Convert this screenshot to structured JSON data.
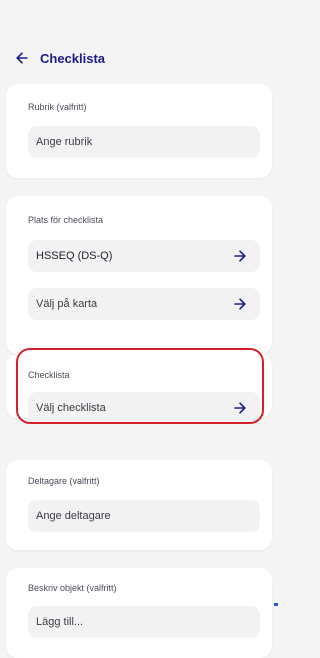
{
  "header": {
    "title": "Checklista",
    "back_icon": "arrow-left-icon"
  },
  "rubrik": {
    "label": "Rubrik (valfritt)",
    "placeholder": "Ange rubrik"
  },
  "plats": {
    "label": "Plats för checklista",
    "items": [
      {
        "value": "HSSEQ (DS-Q)",
        "icon": "arrow-right-icon"
      },
      {
        "value": "Välj på karta",
        "icon": "arrow-right-icon"
      }
    ]
  },
  "checklista": {
    "label": "Checklista",
    "placeholder": "Välj checklista",
    "icon": "arrow-right-icon"
  },
  "deltagare": {
    "label": "Deltagare (valfritt)",
    "placeholder": "Ange deltagare"
  },
  "beskriv": {
    "label": "Beskriv objekt (valfritt)",
    "placeholder": "Lägg till..."
  },
  "colors": {
    "accent": "#1c1c8a",
    "highlight": "#d6202c",
    "background": "#f4f4f4",
    "field": "#f2f2f2"
  }
}
